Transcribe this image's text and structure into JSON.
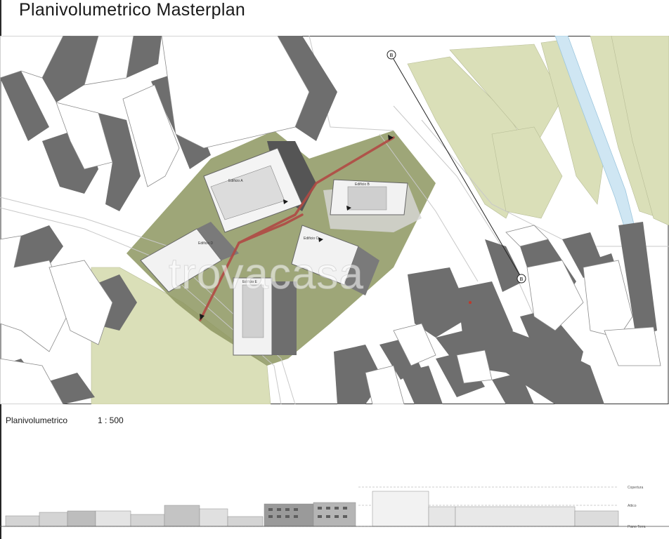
{
  "header": {
    "title": "Planivolumetrico Masterplan"
  },
  "plan": {
    "watermark": "trovacasa",
    "section_marker_top": "B",
    "section_marker_bottom": "B",
    "buildings": [
      {
        "label": "Edificio A"
      },
      {
        "label": "Edificio B"
      },
      {
        "label": "Edificio C"
      },
      {
        "label": "Edificio D"
      },
      {
        "label": "Edificio E"
      }
    ]
  },
  "caption": {
    "label": "Planivolumetrico",
    "scale": "1 : 500"
  },
  "section_view": {
    "levels": [
      "Copertura",
      "Attico",
      "Piano Terra"
    ]
  },
  "colors": {
    "shadow": "#6e6e6e",
    "green": "#8d9660",
    "pale_green": "#dadfb8",
    "water": "#cfe6f3",
    "path": "#b04a44"
  }
}
